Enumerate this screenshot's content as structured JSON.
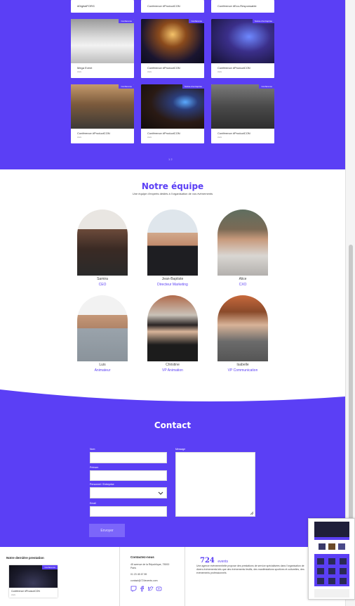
{
  "colors": {
    "accent": "#5b3ff5",
    "button": "#7c66fa",
    "white": "#ffffff"
  },
  "events": {
    "top_cards": [
      {
        "title": "#DigitalFORG",
        "sub": "xxxxx"
      },
      {
        "title": "Conference #ProductCON",
        "sub": "xxxxx"
      },
      {
        "title": "Conférence #Eco-Responsable",
        "sub": "xxxx"
      }
    ],
    "cards": [
      {
        "title": "Mega Event",
        "sub": "xxxx",
        "tag": "Conférence"
      },
      {
        "title": "Conférence #ProductCON",
        "sub": "xxxx",
        "tag": "Conférence"
      },
      {
        "title": "Conférence #ProductCON",
        "sub": "xxxx",
        "tag": "Soirée d'entreprise"
      },
      {
        "title": "Conférence #ProductCON",
        "sub": "xxxx",
        "tag": "Conférence"
      },
      {
        "title": "Conférence #ProductCON",
        "sub": "xxxx",
        "tag": "Soirée d'entreprise"
      },
      {
        "title": "Conférence #ProductCON",
        "sub": "xxxx",
        "tag": "Conférence"
      }
    ],
    "pager": "1 2"
  },
  "team": {
    "title": "Notre équipe",
    "subtitle": "Une équipe d'experts dédiés à l'organisation de vos événements",
    "members": [
      {
        "name": "Samira",
        "role": "CEO"
      },
      {
        "name": "Jean-Baptiste",
        "role": "Directeur Marketing"
      },
      {
        "name": "Alice",
        "role": "CXO"
      },
      {
        "name": "Luis",
        "role": "Animateur"
      },
      {
        "name": "Christine",
        "role": "VP Animation"
      },
      {
        "name": "Isabelle",
        "role": "VP Communication"
      }
    ]
  },
  "contact": {
    "title": "Contact",
    "fields": {
      "nom": "Nom",
      "prenom": "Prénom",
      "type": "Personnel / Entreprise",
      "email": "Email",
      "message": "Message"
    },
    "send": "Envoyer"
  },
  "footer": {
    "last_title": "Notre dernière prestation",
    "last_card_title": "Conférence #ProductCON",
    "last_card_sub": "xxxx",
    "last_card_tag": "Conférence",
    "contact_title": "Contactez-nous",
    "address_1": "45 avenue de la République, 75000",
    "address_2": "Paris",
    "phone": "01 23 45 67 89",
    "email": "contact@724events.com",
    "logo_num": "724",
    "logo_word": "events",
    "about": "Une agence événementielle propose des prestations de service spécialisées dans l'organisation de divers événements tels que des événements festifs, des manifestations sportives et culturelles, des événements professionnels"
  },
  "icons": [
    "twitch-icon",
    "facebook-icon",
    "twitter-icon",
    "youtube-icon"
  ]
}
